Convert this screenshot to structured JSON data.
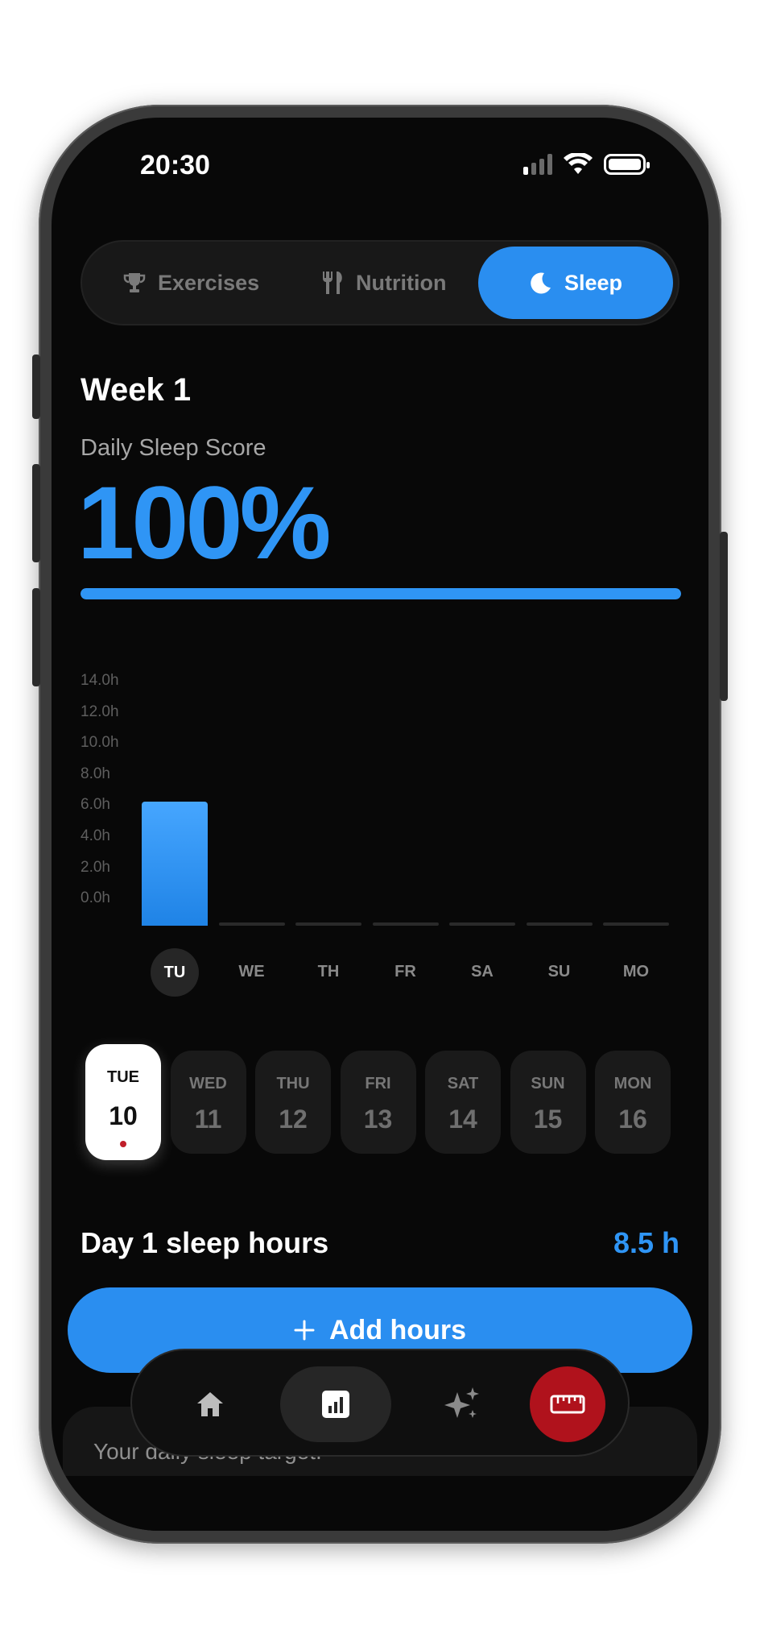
{
  "status_bar": {
    "time": "20:30"
  },
  "tabs": [
    {
      "label": "Exercises",
      "icon": "trophy-icon",
      "active": false
    },
    {
      "label": "Nutrition",
      "icon": "fork-knife-icon",
      "active": false
    },
    {
      "label": "Sleep",
      "icon": "moon-icon",
      "active": true
    }
  ],
  "summary": {
    "week": "Week 1",
    "score_label": "Daily Sleep Score",
    "score_value": "100%",
    "score_progress": 1.0
  },
  "chart_data": {
    "type": "bar",
    "categories": [
      "TU",
      "WE",
      "TH",
      "FR",
      "SA",
      "SU",
      "MO"
    ],
    "values": [
      8.0,
      0,
      0,
      0,
      0,
      0,
      0
    ],
    "ylim": [
      0,
      14
    ],
    "yticks": [
      "14.0h",
      "12.0h",
      "10.0h",
      "8.0h",
      "6.0h",
      "4.0h",
      "2.0h",
      "0.0h"
    ],
    "selected": "TU",
    "grid": false
  },
  "dates": [
    {
      "day": "TUE",
      "num": "10",
      "selected": true
    },
    {
      "day": "WED",
      "num": "11",
      "selected": false
    },
    {
      "day": "THU",
      "num": "12",
      "selected": false
    },
    {
      "day": "FRI",
      "num": "13",
      "selected": false
    },
    {
      "day": "SAT",
      "num": "14",
      "selected": false
    },
    {
      "day": "SUN",
      "num": "15",
      "selected": false
    },
    {
      "day": "MON",
      "num": "16",
      "selected": false
    }
  ],
  "day_section": {
    "title": "Day 1 sleep hours",
    "value": "8.5 h"
  },
  "add_button": {
    "label": "Add hours",
    "icon": "plus-icon"
  },
  "target_card": {
    "text": "Your daily sleep target."
  },
  "nav": [
    {
      "icon": "home-icon",
      "active": false
    },
    {
      "icon": "chart-icon",
      "active": true
    },
    {
      "icon": "sparkle-icon",
      "active": false
    },
    {
      "icon": "ruler-icon",
      "active": false
    }
  ],
  "colors": {
    "accent": "#2f95f5",
    "button": "#2a8ef0",
    "danger": "#b0121c",
    "background": "#080808"
  }
}
